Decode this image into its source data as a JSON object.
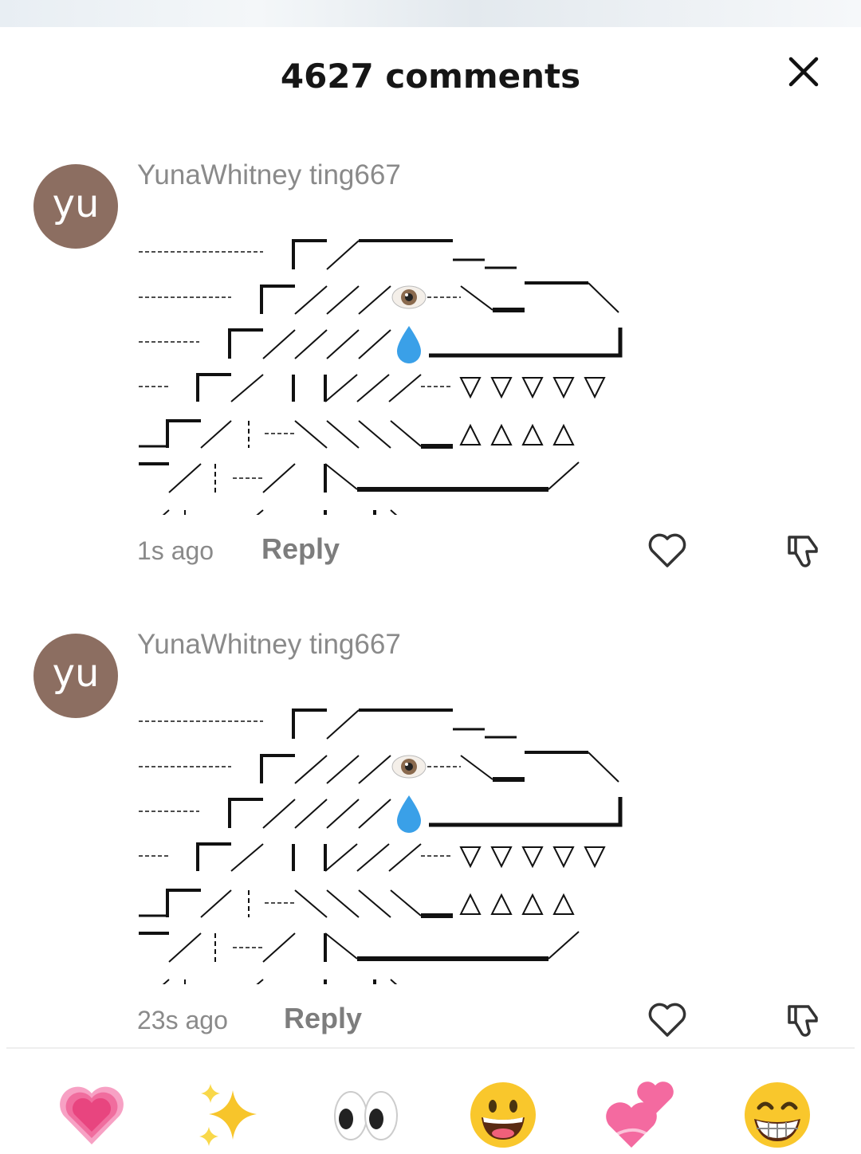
{
  "header": {
    "title": "4627 comments",
    "close_icon": "close-icon"
  },
  "comments": [
    {
      "avatar_text": "yu",
      "username": "YunaWhitney ting667",
      "art": "ascii-art-dinosaur-with-eye-and-teardrop",
      "timestamp": "1s ago",
      "reply_label": "Reply"
    },
    {
      "avatar_text": "yu",
      "username": "YunaWhitney ting667",
      "art": "ascii-art-dinosaur-with-eye-and-teardrop",
      "timestamp": "23s ago",
      "reply_label": "Reply"
    }
  ],
  "emoji_bar": [
    "pink-heart",
    "sparkles",
    "eyes",
    "grinning-face",
    "two-hearts",
    "beaming-face"
  ],
  "colors": {
    "avatar_bg": "#8c6e61",
    "secondary_text": "#8a8a8a",
    "reply_text": "#7d7d7d"
  }
}
